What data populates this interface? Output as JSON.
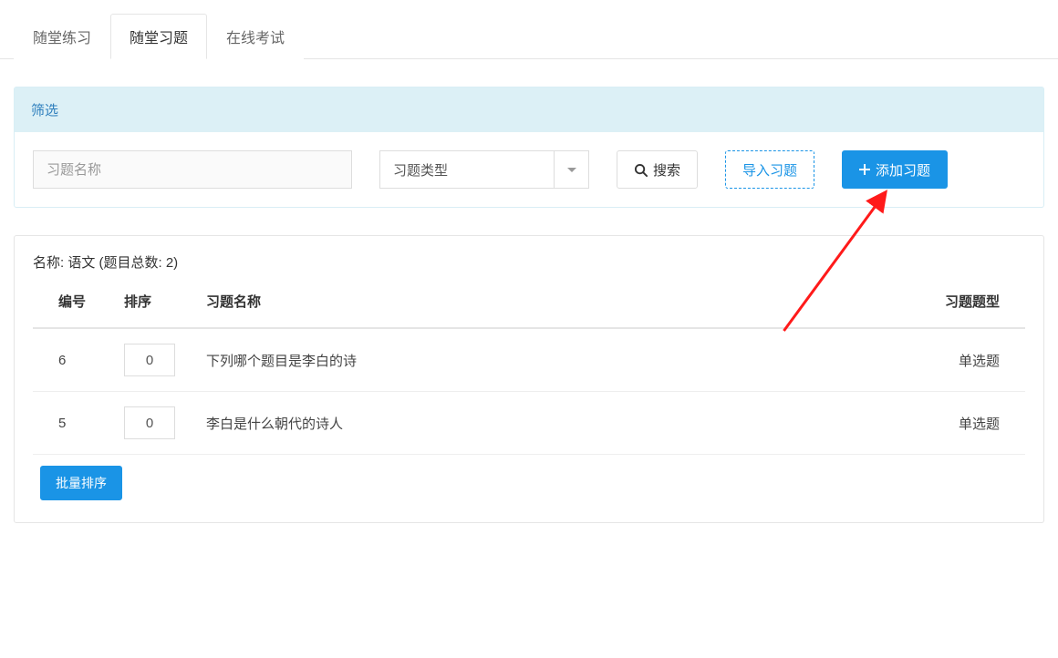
{
  "tabs": [
    {
      "label": "随堂练习"
    },
    {
      "label": "随堂习题"
    },
    {
      "label": "在线考试"
    }
  ],
  "activeTabIndex": 1,
  "filter": {
    "title": "筛选",
    "name_placeholder": "习题名称",
    "type_select_label": "习题类型",
    "search_label": "搜索",
    "import_label": "导入习题",
    "add_label": "添加习题"
  },
  "content": {
    "title": "名称: 语文  (题目总数:  2)",
    "columns": {
      "id": "编号",
      "sort": "排序",
      "name": "习题名称",
      "type": "习题题型"
    },
    "rows": [
      {
        "id": "6",
        "sort": "0",
        "name": "下列哪个题目是李白的诗",
        "type": "单选题"
      },
      {
        "id": "5",
        "sort": "0",
        "name": "李白是什么朝代的诗人",
        "type": "单选题"
      }
    ],
    "batch_sort_label": "批量排序"
  }
}
